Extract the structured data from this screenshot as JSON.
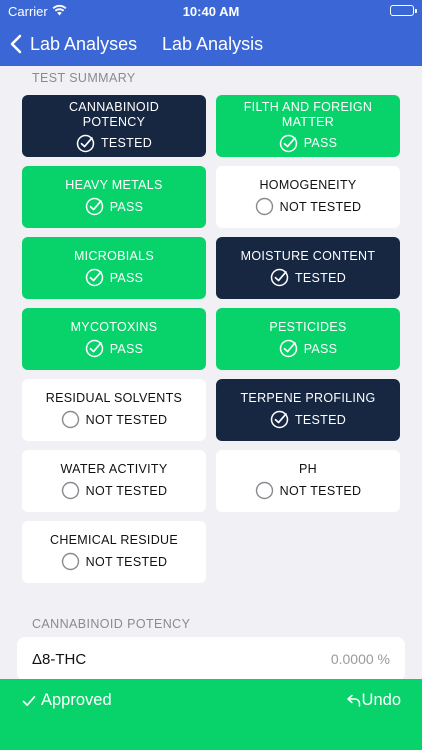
{
  "status_bar": {
    "carrier": "Carrier",
    "time": "10:40 AM"
  },
  "nav": {
    "back_label": "Lab Analyses",
    "title": "Lab Analysis"
  },
  "summary": {
    "header": "TEST SUMMARY",
    "tiles": [
      {
        "name": "CANNABINOID POTENCY",
        "status": "TESTED",
        "state": "tested"
      },
      {
        "name": "FILTH AND FOREIGN MATTER",
        "status": "PASS",
        "state": "pass"
      },
      {
        "name": "HEAVY METALS",
        "status": "PASS",
        "state": "pass"
      },
      {
        "name": "HOMOGENEITY",
        "status": "NOT TESTED",
        "state": "not-tested"
      },
      {
        "name": "MICROBIALS",
        "status": "PASS",
        "state": "pass"
      },
      {
        "name": "MOISTURE CONTENT",
        "status": "TESTED",
        "state": "tested"
      },
      {
        "name": "MYCOTOXINS",
        "status": "PASS",
        "state": "pass"
      },
      {
        "name": "PESTICIDES",
        "status": "PASS",
        "state": "pass"
      },
      {
        "name": "RESIDUAL SOLVENTS",
        "status": "NOT TESTED",
        "state": "not-tested"
      },
      {
        "name": "TERPENE PROFILING",
        "status": "TESTED",
        "state": "tested"
      },
      {
        "name": "WATER ACTIVITY",
        "status": "NOT TESTED",
        "state": "not-tested"
      },
      {
        "name": "PH",
        "status": "NOT TESTED",
        "state": "not-tested"
      },
      {
        "name": "CHEMICAL RESIDUE",
        "status": "NOT TESTED",
        "state": "not-tested"
      }
    ]
  },
  "potency": {
    "header": "CANNABINOID POTENCY",
    "rows": [
      {
        "name": "Δ8-THC",
        "value": "0.0000 %"
      }
    ]
  },
  "bottom": {
    "approved_label": "Approved",
    "undo_label": "Undo"
  },
  "colors": {
    "nav": "#3a66d6",
    "tested": "#172742",
    "pass": "#08d36b",
    "not_tested": "#ffffff"
  }
}
